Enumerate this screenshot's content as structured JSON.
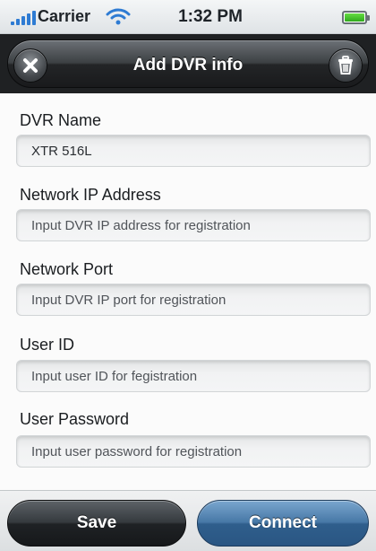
{
  "status_bar": {
    "carrier": "Carrier",
    "time": "1:32 PM",
    "icons": [
      "signal-bars-icon",
      "wifi-icon",
      "battery-icon"
    ]
  },
  "nav_bar": {
    "title": "Add DVR info",
    "left_icon": "close-icon",
    "right_icon": "trash-icon"
  },
  "form": {
    "fields": [
      {
        "label": "DVR Name",
        "value": "XTR 516L",
        "placeholder": ""
      },
      {
        "label": "Network IP Address",
        "value": "",
        "placeholder": "Input DVR IP address for registration"
      },
      {
        "label": "Network Port",
        "value": "",
        "placeholder": "Input DVR IP port for registration"
      },
      {
        "label": "User ID",
        "value": "",
        "placeholder": "Input user ID for fegistration"
      },
      {
        "label": "User Password",
        "value": "",
        "placeholder": "Input user password for registration"
      }
    ]
  },
  "toolbar": {
    "save_label": "Save",
    "connect_label": "Connect"
  },
  "colors": {
    "nav_background": "#1f2123",
    "save_button": "#2a2e32",
    "connect_button": "#3f6f9e",
    "signal": "#2e7bd3",
    "battery": "#3fbf2a"
  }
}
